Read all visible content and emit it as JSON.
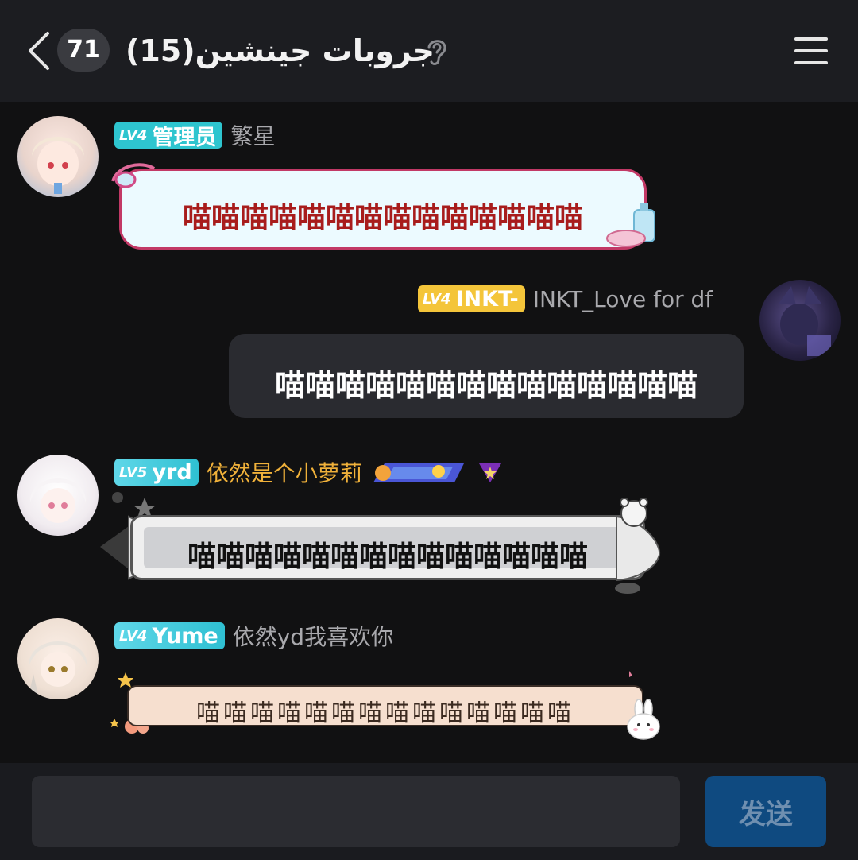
{
  "header": {
    "unread_count": "71",
    "room_title": "(15)جروبات جينشين",
    "icons": [
      "back-icon",
      "ear-icon",
      "menu-icon"
    ]
  },
  "messages": [
    {
      "level": "LV4",
      "badge": "管理员",
      "nickname": "繁星",
      "text": "喵喵喵喵喵喵喵喵喵喵喵喵喵喵",
      "side": "left"
    },
    {
      "level": "LV4",
      "badge": "INKT-",
      "nickname": "INKT_Love for df",
      "text": "喵喵喵喵喵喵喵喵喵喵喵喵喵喵",
      "side": "right"
    },
    {
      "level": "LV5",
      "badge": "yrd",
      "nickname": "依然是个小萝莉",
      "text": "喵喵喵喵喵喵喵喵喵喵喵喵喵喵",
      "side": "left"
    },
    {
      "level": "LV4",
      "badge": "Yume",
      "nickname": "依然yd我喜欢你",
      "text": "喵喵喵喵喵喵喵喵喵喵喵喵喵喵",
      "side": "left"
    }
  ],
  "composer": {
    "placeholder": "",
    "send_label": "发送"
  },
  "colors": {
    "background": "#111112",
    "header": "#1c1d21",
    "badge_teal": "#2ec5cf",
    "badge_yellow": "#f4c53a",
    "nick_gold": "#f0b13a",
    "send_button": "#0f4a80"
  }
}
